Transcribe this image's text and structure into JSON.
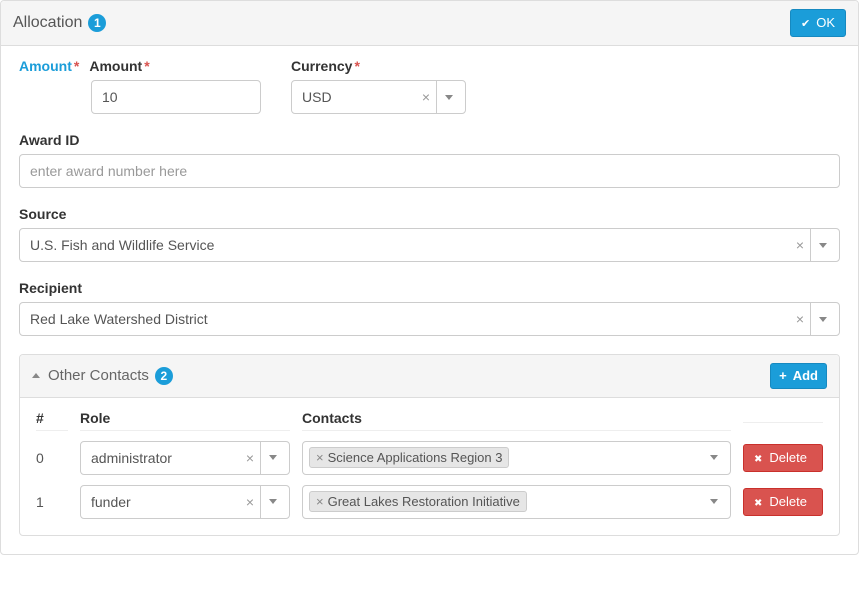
{
  "panel": {
    "title": "Allocation",
    "badge": "1",
    "ok_label": "OK"
  },
  "amount": {
    "tab_label": "Amount",
    "label": "Amount",
    "value": "10"
  },
  "currency": {
    "label": "Currency",
    "value": "USD"
  },
  "award_id": {
    "label": "Award ID",
    "value": "",
    "placeholder": "enter award number here"
  },
  "source": {
    "label": "Source",
    "value": "U.S. Fish and Wildlife Service"
  },
  "recipient": {
    "label": "Recipient",
    "value": "Red Lake Watershed District"
  },
  "other_contacts": {
    "title": "Other Contacts",
    "badge": "2",
    "add_label": "Add",
    "columns": {
      "idx": "#",
      "role": "Role",
      "contacts": "Contacts"
    },
    "delete_label": "Delete",
    "rows": [
      {
        "idx": "0",
        "role": "administrator",
        "contact": "Science Applications Region 3"
      },
      {
        "idx": "1",
        "role": "funder",
        "contact": "Great Lakes Restoration Initiative"
      }
    ]
  }
}
